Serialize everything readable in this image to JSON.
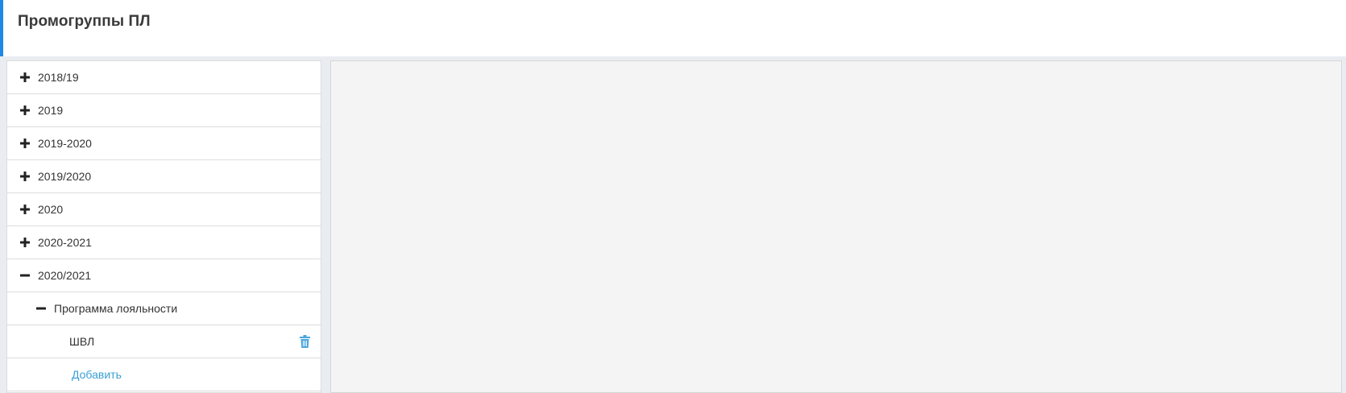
{
  "header": {
    "title": "Промогруппы ПЛ"
  },
  "colors": {
    "accent": "#1e88e5",
    "link": "#3a9fd6",
    "border": "#dcdcdc",
    "content_background": "#f4f4f4"
  },
  "tree": {
    "items": [
      {
        "label": "2018/19",
        "state": "collapsed",
        "icon": "plus-icon"
      },
      {
        "label": "2019",
        "state": "collapsed",
        "icon": "plus-icon"
      },
      {
        "label": "2019-2020",
        "state": "collapsed",
        "icon": "plus-icon"
      },
      {
        "label": "2019/2020",
        "state": "collapsed",
        "icon": "plus-icon"
      },
      {
        "label": "2020",
        "state": "collapsed",
        "icon": "plus-icon"
      },
      {
        "label": "2020-2021",
        "state": "collapsed",
        "icon": "plus-icon"
      },
      {
        "label": "2020/2021",
        "state": "expanded",
        "icon": "minus-icon"
      }
    ],
    "subgroup": {
      "label": "Программа лояльности",
      "state": "expanded",
      "icon": "minus-icon"
    },
    "leaf": {
      "label": "ШВЛ",
      "action_icon": "trash-icon"
    },
    "add_label": "Добавить"
  }
}
